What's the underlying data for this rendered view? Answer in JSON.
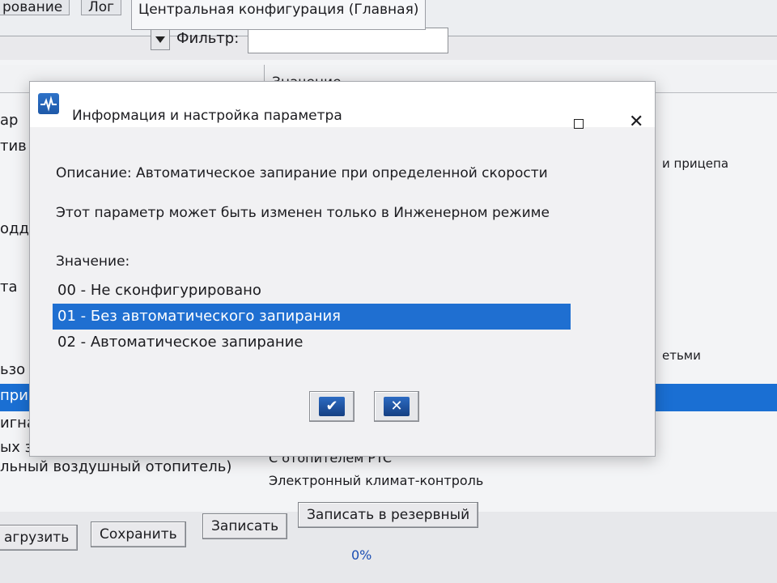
{
  "tabs": [
    {
      "label": "рование"
    },
    {
      "label": "Лог"
    },
    {
      "label": "Центральная конфигурация (Главная)"
    }
  ],
  "filter": {
    "label": "Фильтр:",
    "value": ""
  },
  "table": {
    "value_column": "Значение"
  },
  "background_left": [
    "ар",
    "тив",
    "одд",
    "та",
    "ьзо",
    "при",
    "игна",
    "ых з"
  ],
  "background_right": {
    "trailer": "и прицепа",
    "bkg3": "етьми"
  },
  "heater_row": {
    "left": "льный воздушный отопитель)",
    "right": "С отопителем PTC"
  },
  "climate_row": {
    "right": "Электронный климат-контроль"
  },
  "bottom_buttons": {
    "load": "агрузить",
    "save": "Сохранить",
    "write": "Записать",
    "write_backup": "Записать в резервный"
  },
  "progress": {
    "percent_text": "0%",
    "percent": 0
  },
  "dialog": {
    "title": "Информация и настройка параметра",
    "description": "Описание: Автоматическое запирание при определенной скорости",
    "note": "Этот параметр может быть изменен только в Инженерном режиме",
    "value_label": "Значение:",
    "options": [
      {
        "label": "00 - Не сконфигурировано",
        "selected": false
      },
      {
        "label": "01 - Без автоматического запирания",
        "selected": true
      },
      {
        "label": "02 - Автоматическое запирание",
        "selected": false
      }
    ],
    "ok_icon": "checkmark-icon",
    "cancel_icon": "x-icon"
  },
  "colors": {
    "selection": "#1f6fd1",
    "title_icon": "#2e73c9"
  }
}
